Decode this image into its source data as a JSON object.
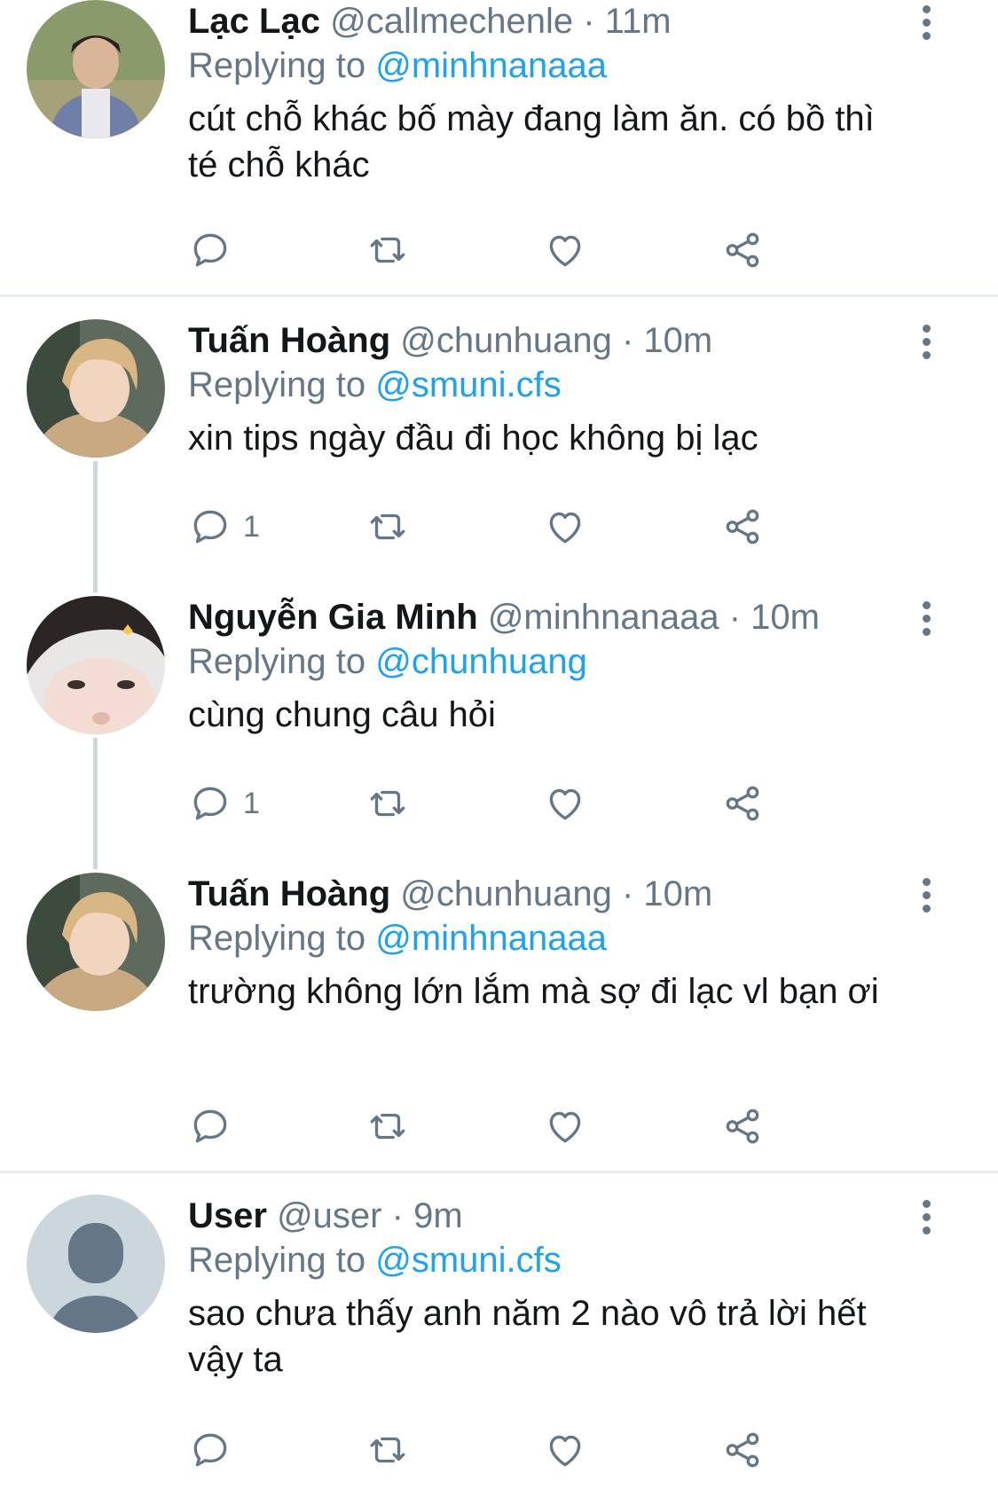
{
  "tweets": [
    {
      "name": "Lạc Lạc",
      "handle": "@callmechenle",
      "time": "11m",
      "replying_label": "Replying to",
      "replying_to": "@minhnanaaa",
      "text": "cút chỗ khác bố mày đang làm ăn. có bồ thì té chỗ khác",
      "reply_count": ""
    },
    {
      "name": "Tuấn Hoàng",
      "handle": "@chunhuang",
      "time": "10m",
      "replying_label": "Replying to",
      "replying_to": "@smuni.cfs",
      "text": "xin tips ngày đầu đi học không bị lạc",
      "reply_count": "1"
    },
    {
      "name": "Nguyễn Gia Minh",
      "handle": "@minhnanaaa",
      "time": "10m",
      "replying_label": "Replying to",
      "replying_to": "@chunhuang",
      "text": "cùng chung câu hỏi",
      "reply_count": "1"
    },
    {
      "name": "Tuấn Hoàng",
      "handle": "@chunhuang",
      "time": "10m",
      "replying_label": "Replying to",
      "replying_to": "@minhnanaaa",
      "text": "trường không lớn lắm mà sợ đi lạc vl bạn ơi",
      "reply_count": ""
    },
    {
      "name": "User",
      "handle": "@user",
      "time": "9m",
      "replying_label": "Replying to",
      "replying_to": "@smuni.cfs",
      "text": "sao chưa thấy anh năm 2 nào vô trả lời hết vậy ta",
      "reply_count": ""
    }
  ],
  "separator": "·",
  "colors": {
    "accent": "#1da1f2",
    "secondary": "#657786",
    "divider": "#e6ecf0",
    "thread": "#ccd6dd"
  },
  "icons": [
    "reply-icon",
    "retweet-icon",
    "like-icon",
    "share-icon",
    "more-icon"
  ]
}
